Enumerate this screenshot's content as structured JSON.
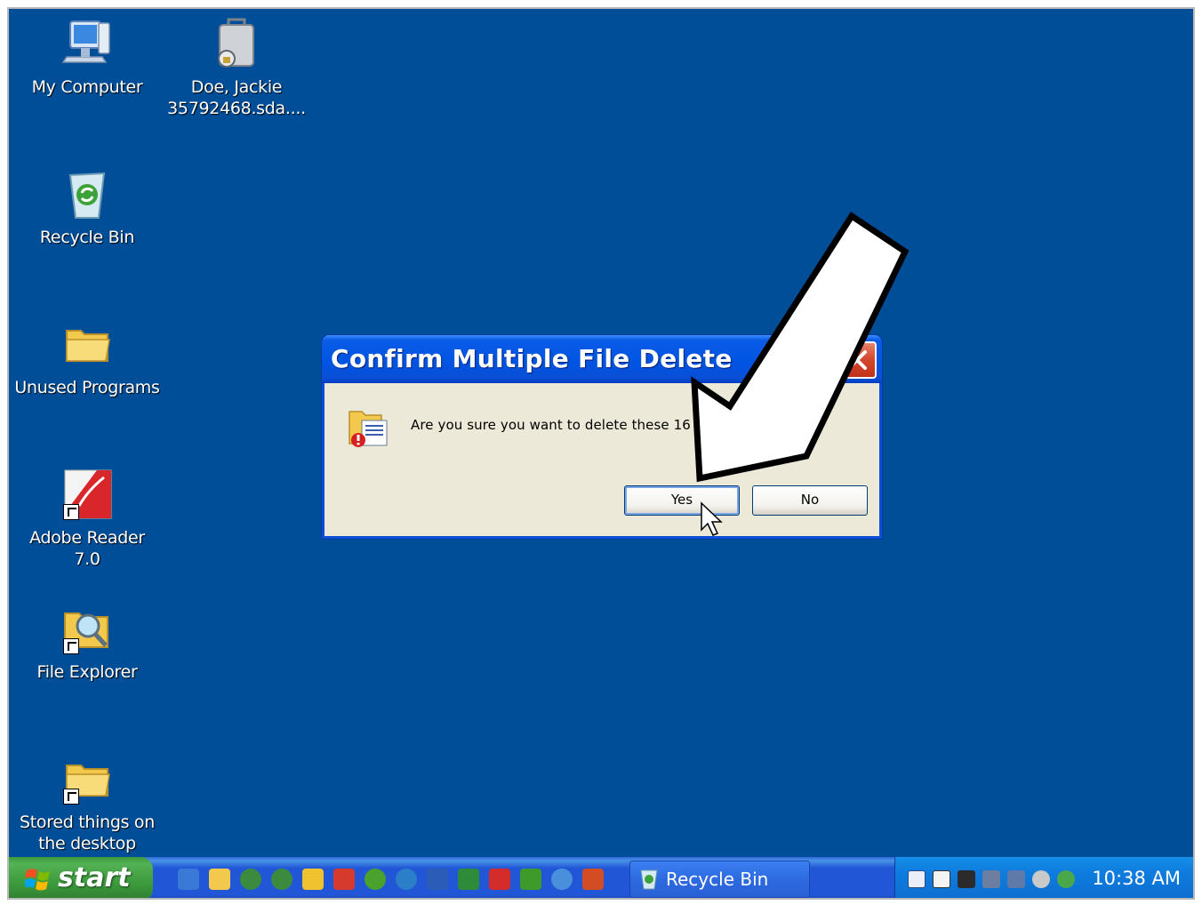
{
  "desktop": {
    "icons": [
      {
        "label": "My Computer",
        "icon": "my-computer-icon"
      },
      {
        "label": "Doe, Jackie\n35792468.sda....",
        "icon": "encrypted-file-icon"
      },
      {
        "label": "Recycle Bin",
        "icon": "recycle-bin-icon"
      },
      {
        "label": "Unused Programs",
        "icon": "folder-icon"
      },
      {
        "label": "Adobe Reader\n7.0",
        "icon": "adobe-reader-icon"
      },
      {
        "label": "File Explorer",
        "icon": "file-explorer-icon"
      },
      {
        "label": "Stored things on\nthe desktop",
        "icon": "folder-shortcut-icon"
      }
    ],
    "background_color": "#004e98"
  },
  "dialog": {
    "title": "Confirm Multiple File Delete",
    "message": "Are you sure you want to delete these 16 ite",
    "yes_label": "Yes",
    "no_label": "No",
    "title_color": "#0054e3"
  },
  "taskbar": {
    "start_label": "start",
    "task_recycle_label": "Recycle Bin",
    "clock": "10:38 AM",
    "quick_launch": [
      "ie-icon",
      "folder-icon",
      "netscape-icon",
      "netscape-icon",
      "notes-icon",
      "tool-icon",
      "itunes-icon",
      "earth-icon",
      "word-icon",
      "excel-icon",
      "acrobat-icon",
      "tree-icon",
      "refresh-icon",
      "powerpoint-icon"
    ]
  }
}
